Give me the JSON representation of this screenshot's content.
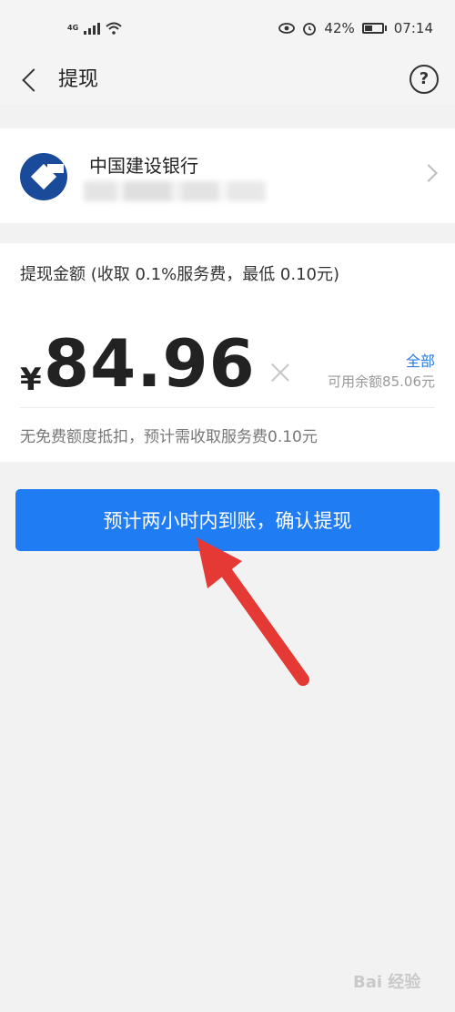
{
  "status_bar": {
    "network": "4G",
    "percent": "42%",
    "time": "07:14",
    "icons": [
      "signal-icon",
      "wifi-icon",
      "eye-icon",
      "alarm-icon",
      "battery-icon"
    ]
  },
  "header": {
    "title": "提现",
    "back_icon": "back-chevron-icon",
    "help_icon": "question-circle-icon",
    "help_text": "?"
  },
  "bank": {
    "name": "中国建设银行",
    "logo_icon": "ccb-logo-icon",
    "chevron_icon": "chevron-right-icon"
  },
  "withdraw": {
    "label": "提现金额 (收取 0.1%服务费，最低 0.10元)",
    "currency": "¥",
    "amount": "84.96",
    "clear_icon": "clear-x-icon",
    "all_label": "全部",
    "available": "可用余额85.06元",
    "fee_note": "无免费额度抵扣，预计需收取服务费0.10元"
  },
  "confirm_button": {
    "label": "预计两小时内到账，确认提现"
  },
  "annotation": {
    "arrow_icon": "red-arrow-icon"
  },
  "watermark": {
    "text": "Bai 经验"
  },
  "colors": {
    "accent": "#1f7cf3",
    "link": "#2c7be5",
    "arrow": "#e53935",
    "bank_blue": "#1a4a9a"
  }
}
